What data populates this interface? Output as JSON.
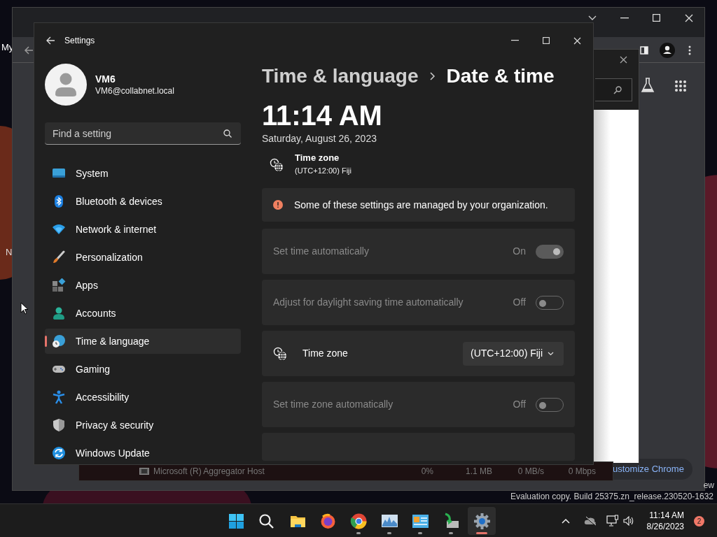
{
  "desktop": {
    "icon_labels": [
      "My",
      "N"
    ],
    "build_info": [
      "ew",
      "Evaluation copy. Build 25375.zn_release.230520-1632"
    ]
  },
  "browser": {
    "customize_label": "ustomize Chrome"
  },
  "task_manager_row": {
    "name": "Microsoft (R) Aggregator Host",
    "cpu": "0%",
    "memory": "1.1 MB",
    "disk": "0 MB/s",
    "network": "0 Mbps"
  },
  "settings": {
    "title": "Settings",
    "user": {
      "name": "VM6",
      "email": "VM6@collabnet.local"
    },
    "search": {
      "placeholder": "Find a setting"
    },
    "nav": [
      {
        "kind": "system",
        "label": "System",
        "selected": false
      },
      {
        "kind": "bluetooth",
        "label": "Bluetooth & devices",
        "selected": false
      },
      {
        "kind": "network",
        "label": "Network & internet",
        "selected": false
      },
      {
        "kind": "brush",
        "label": "Personalization",
        "selected": false
      },
      {
        "kind": "apps",
        "label": "Apps",
        "selected": false
      },
      {
        "kind": "accounts",
        "label": "Accounts",
        "selected": false
      },
      {
        "kind": "time",
        "label": "Time & language",
        "selected": true
      },
      {
        "kind": "gaming",
        "label": "Gaming",
        "selected": false
      },
      {
        "kind": "accessibility",
        "label": "Accessibility",
        "selected": false
      },
      {
        "kind": "shield",
        "label": "Privacy & security",
        "selected": false
      },
      {
        "kind": "update",
        "label": "Windows Update",
        "selected": false
      }
    ],
    "breadcrumb": {
      "parent": "Time & language",
      "current": "Date & time"
    },
    "clock": {
      "time": "11:14 AM",
      "date": "Saturday, August 26, 2023"
    },
    "time_zone_summary": {
      "label": "Time zone",
      "value": "(UTC+12:00) Fiji"
    },
    "notice": "Some of these settings are managed by your organization.",
    "rows": [
      {
        "kind": "toggle",
        "label": "Set time automatically",
        "state_label": "On",
        "on": true,
        "disabled": true
      },
      {
        "kind": "toggle",
        "label": "Adjust for daylight saving time automatically",
        "state_label": "Off",
        "on": false,
        "disabled": true
      },
      {
        "kind": "dropdown",
        "label": "Time zone",
        "value": "(UTC+12:00) Fiji"
      },
      {
        "kind": "toggle",
        "label": "Set time zone automatically",
        "state_label": "Off",
        "on": false,
        "disabled": true
      }
    ]
  },
  "taskbar": {
    "apps": [
      {
        "kind": "start",
        "running": false,
        "active": false
      },
      {
        "kind": "search",
        "running": false,
        "active": false
      },
      {
        "kind": "folder",
        "running": false,
        "active": false
      },
      {
        "kind": "firefox",
        "running": false,
        "active": false
      },
      {
        "kind": "chrome",
        "running": true,
        "active": false
      },
      {
        "kind": "monitor",
        "running": true,
        "active": false
      },
      {
        "kind": "panel",
        "running": true,
        "active": false
      },
      {
        "kind": "deploy",
        "running": true,
        "active": false
      },
      {
        "kind": "gear",
        "running": true,
        "active": true
      }
    ],
    "clock": {
      "time": "11:14 AM",
      "date": "8/26/2023"
    },
    "notification_count": "2"
  }
}
